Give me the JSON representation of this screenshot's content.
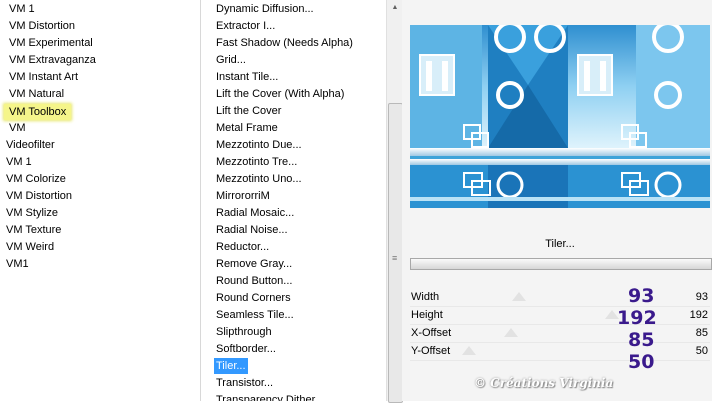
{
  "categories": [
    "VM 1",
    "VM Distortion",
    "VM Experimental",
    "VM Extravaganza",
    "VM Instant Art",
    "VM Natural",
    "VM Toolbox",
    "VM",
    "Videofilter",
    "VM 1",
    "VM Colorize",
    "VM Distortion",
    "VM Stylize",
    "VM Texture",
    "VM Weird",
    "VM1"
  ],
  "selected_category": "VM Toolbox",
  "filters": [
    "Dynamic Diffusion...",
    "Extractor I...",
    "Fast Shadow (Needs Alpha)",
    "Grid...",
    "Instant Tile...",
    "Lift the Cover (With Alpha)",
    "Lift the Cover",
    "Metal Frame",
    "Mezzotinto Due...",
    "Mezzotinto Tre...",
    "Mezzotinto Uno...",
    "MirrororriM",
    "Radial Mosaic...",
    "Radial Noise...",
    "Reductor...",
    "Remove Gray...",
    "Round Button...",
    "Round Corners",
    "Seamless Tile...",
    "Slipthrough",
    "Softborder...",
    "Tiler...",
    "Transistor...",
    "Transparency Dither"
  ],
  "selected_filter": "Tiler...",
  "filter_name": "Tiler...",
  "params": [
    {
      "label": "Width",
      "value": "93",
      "big": "93"
    },
    {
      "label": "Height",
      "value": "192",
      "big": "192"
    },
    {
      "label": "X-Offset",
      "value": "85",
      "big": "85"
    },
    {
      "label": "Y-Offset",
      "value": "50",
      "big": "50"
    }
  ],
  "watermark": "© Créations Virginia",
  "colors": {
    "selection": "#3399ff",
    "category_highlight": "#f5f58a",
    "preview_blue": "#3ea3d9",
    "annotation": "#3a1a8c"
  }
}
